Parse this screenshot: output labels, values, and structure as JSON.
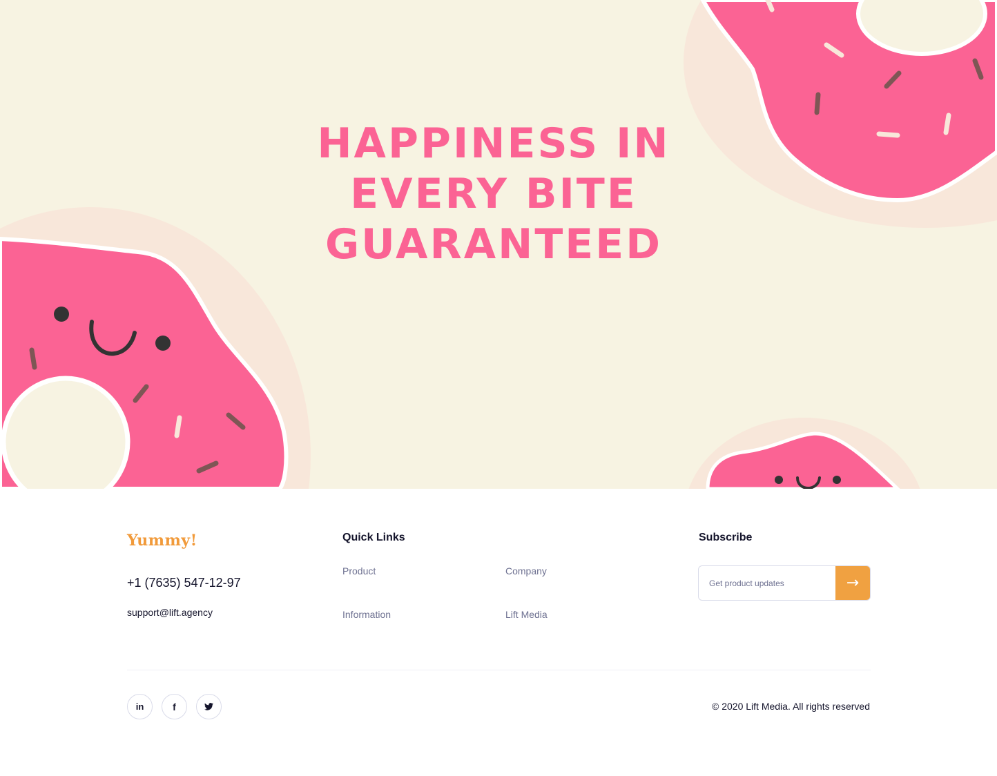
{
  "hero": {
    "headline_lines": [
      "HAPPINESS IN",
      "EVERY BITE",
      "GUARANTEED"
    ]
  },
  "colors": {
    "hero_background": "#f7f3e2",
    "donut_pink": "#fb6394",
    "plate": "#f8e7da",
    "accent_orange": "#f0a141",
    "text_dark": "#14142b",
    "text_muted": "#6e7191"
  },
  "footer": {
    "brand": {
      "logo_text": "Yummy!",
      "phone": "+1 (7635) 547-12-97",
      "email": "support@lift.agency"
    },
    "quick_links": {
      "title": "Quick Links",
      "items": [
        {
          "label": "Product"
        },
        {
          "label": "Company"
        },
        {
          "label": "Information"
        },
        {
          "label": "Lift Media"
        }
      ]
    },
    "subscribe": {
      "title": "Subscribe",
      "placeholder": "Get product updates",
      "button_icon": "arrow-right-icon",
      "button_glyph": "→"
    },
    "social": [
      {
        "name": "linkedin-icon",
        "glyph": "in"
      },
      {
        "name": "facebook-icon",
        "glyph": "f"
      },
      {
        "name": "twitter-icon",
        "glyph": "twitter"
      }
    ],
    "copyright": "© 2020 Lift Media. All rights reserved"
  }
}
